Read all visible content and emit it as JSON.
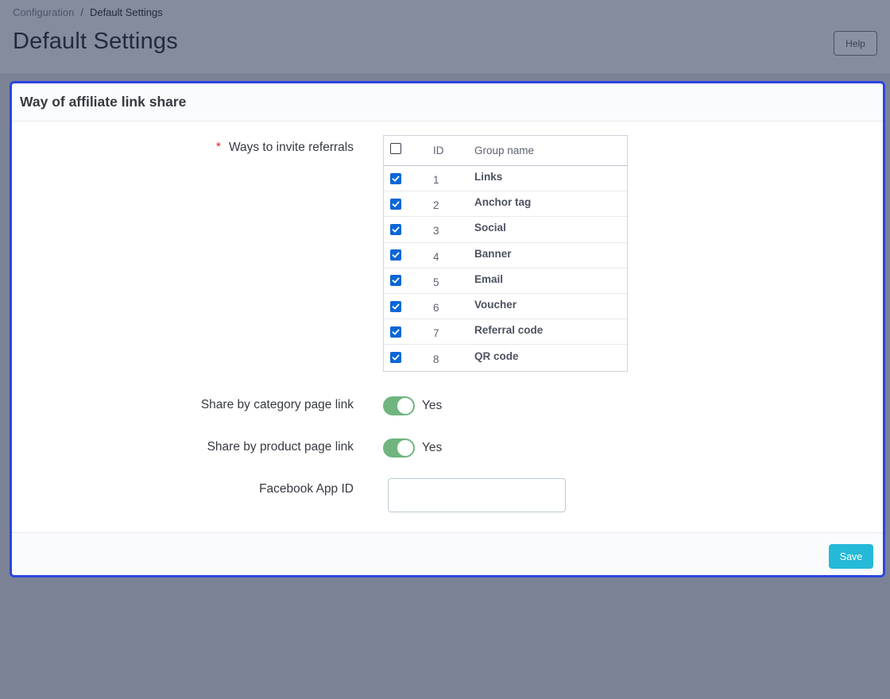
{
  "breadcrumb": {
    "parent": "Configuration",
    "separator": "/",
    "current": "Default Settings"
  },
  "header": {
    "title": "Default Settings",
    "help_label": "Help"
  },
  "panel": {
    "title": "Way of affiliate link share",
    "fields": {
      "ways_label": "Ways to invite referrals",
      "required_mark": "*",
      "category_label": "Share by category page link",
      "category_value": "Yes",
      "category_enabled": true,
      "product_label": "Share by product page link",
      "product_value": "Yes",
      "product_enabled": true,
      "facebook_label": "Facebook App ID",
      "facebook_value": ""
    },
    "table": {
      "headers": {
        "id": "ID",
        "name": "Group name"
      },
      "select_all_checked": false,
      "rows": [
        {
          "id": "1",
          "name": "Links",
          "checked": true
        },
        {
          "id": "2",
          "name": "Anchor tag",
          "checked": true
        },
        {
          "id": "3",
          "name": "Social",
          "checked": true
        },
        {
          "id": "4",
          "name": "Banner",
          "checked": true
        },
        {
          "id": "5",
          "name": "Email",
          "checked": true
        },
        {
          "id": "6",
          "name": "Voucher",
          "checked": true
        },
        {
          "id": "7",
          "name": "Referral code",
          "checked": true
        },
        {
          "id": "8",
          "name": "QR code",
          "checked": true
        }
      ]
    },
    "save_label": "Save"
  },
  "colors": {
    "accent": "#25b9d7",
    "focus_border": "#2b44e0",
    "switch_on": "#70b580",
    "checkbox_on": "#0b66d6"
  }
}
